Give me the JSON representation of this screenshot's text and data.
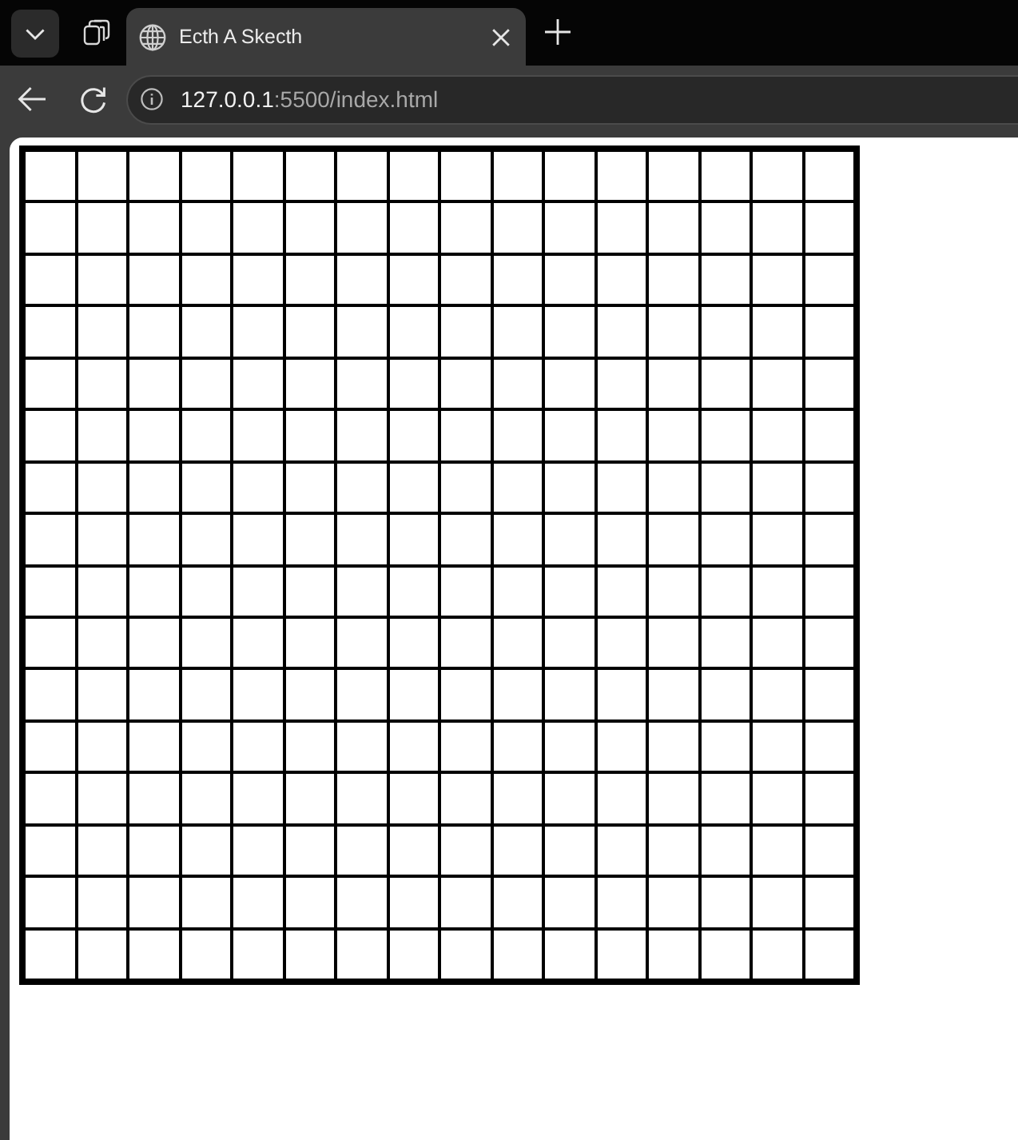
{
  "browser": {
    "tabs": [
      {
        "title": "Ecth A Skecth",
        "selected": true
      }
    ],
    "address_bar": {
      "host": "127.0.0.1",
      "path": ":5500/index.html"
    }
  },
  "page": {
    "grid": {
      "rows": [
        {
          "cells": [
            {
              "filled": false
            },
            {
              "filled": false
            },
            {
              "filled": false
            },
            {
              "filled": false
            },
            {
              "filled": false
            },
            {
              "filled": false
            },
            {
              "filled": false
            },
            {
              "filled": false
            },
            {
              "filled": false
            },
            {
              "filled": false
            },
            {
              "filled": false
            },
            {
              "filled": false
            },
            {
              "filled": false
            },
            {
              "filled": false
            },
            {
              "filled": false
            },
            {
              "filled": false
            }
          ]
        },
        {
          "cells": [
            {
              "filled": false
            },
            {
              "filled": false
            },
            {
              "filled": false
            },
            {
              "filled": false
            },
            {
              "filled": false
            },
            {
              "filled": false
            },
            {
              "filled": false
            },
            {
              "filled": false
            },
            {
              "filled": false
            },
            {
              "filled": false
            },
            {
              "filled": false
            },
            {
              "filled": false
            },
            {
              "filled": false
            },
            {
              "filled": false
            },
            {
              "filled": false
            },
            {
              "filled": false
            }
          ]
        },
        {
          "cells": [
            {
              "filled": false
            },
            {
              "filled": false
            },
            {
              "filled": false
            },
            {
              "filled": false
            },
            {
              "filled": false
            },
            {
              "filled": false
            },
            {
              "filled": false
            },
            {
              "filled": false
            },
            {
              "filled": false
            },
            {
              "filled": false
            },
            {
              "filled": false
            },
            {
              "filled": false
            },
            {
              "filled": false
            },
            {
              "filled": false
            },
            {
              "filled": false
            },
            {
              "filled": false
            }
          ]
        },
        {
          "cells": [
            {
              "filled": false
            },
            {
              "filled": false
            },
            {
              "filled": false
            },
            {
              "filled": false
            },
            {
              "filled": false
            },
            {
              "filled": false
            },
            {
              "filled": false
            },
            {
              "filled": false
            },
            {
              "filled": false
            },
            {
              "filled": false
            },
            {
              "filled": false
            },
            {
              "filled": false
            },
            {
              "filled": false
            },
            {
              "filled": false
            },
            {
              "filled": false
            },
            {
              "filled": false
            }
          ]
        },
        {
          "cells": [
            {
              "filled": false
            },
            {
              "filled": false
            },
            {
              "filled": false
            },
            {
              "filled": false
            },
            {
              "filled": false
            },
            {
              "filled": false
            },
            {
              "filled": false
            },
            {
              "filled": false
            },
            {
              "filled": false
            },
            {
              "filled": false
            },
            {
              "filled": false
            },
            {
              "filled": false
            },
            {
              "filled": false
            },
            {
              "filled": false
            },
            {
              "filled": false
            },
            {
              "filled": false
            }
          ]
        },
        {
          "cells": [
            {
              "filled": false
            },
            {
              "filled": false
            },
            {
              "filled": false
            },
            {
              "filled": false
            },
            {
              "filled": false
            },
            {
              "filled": false
            },
            {
              "filled": false
            },
            {
              "filled": false
            },
            {
              "filled": false
            },
            {
              "filled": false
            },
            {
              "filled": false
            },
            {
              "filled": false
            },
            {
              "filled": false
            },
            {
              "filled": false
            },
            {
              "filled": false
            },
            {
              "filled": false
            }
          ]
        },
        {
          "cells": [
            {
              "filled": false
            },
            {
              "filled": false
            },
            {
              "filled": false
            },
            {
              "filled": false
            },
            {
              "filled": false
            },
            {
              "filled": false
            },
            {
              "filled": false
            },
            {
              "filled": false
            },
            {
              "filled": false
            },
            {
              "filled": false
            },
            {
              "filled": false
            },
            {
              "filled": false
            },
            {
              "filled": false
            },
            {
              "filled": false
            },
            {
              "filled": false
            },
            {
              "filled": false
            }
          ]
        },
        {
          "cells": [
            {
              "filled": false
            },
            {
              "filled": false
            },
            {
              "filled": false
            },
            {
              "filled": false
            },
            {
              "filled": false
            },
            {
              "filled": false
            },
            {
              "filled": false
            },
            {
              "filled": false
            },
            {
              "filled": false
            },
            {
              "filled": false
            },
            {
              "filled": false
            },
            {
              "filled": false
            },
            {
              "filled": false
            },
            {
              "filled": false
            },
            {
              "filled": false
            },
            {
              "filled": false
            }
          ]
        },
        {
          "cells": [
            {
              "filled": false
            },
            {
              "filled": false
            },
            {
              "filled": false
            },
            {
              "filled": false
            },
            {
              "filled": false
            },
            {
              "filled": false
            },
            {
              "filled": false
            },
            {
              "filled": false
            },
            {
              "filled": false
            },
            {
              "filled": false
            },
            {
              "filled": false
            },
            {
              "filled": false
            },
            {
              "filled": false
            },
            {
              "filled": false
            },
            {
              "filled": false
            },
            {
              "filled": false
            }
          ]
        },
        {
          "cells": [
            {
              "filled": false
            },
            {
              "filled": false
            },
            {
              "filled": false
            },
            {
              "filled": false
            },
            {
              "filled": false
            },
            {
              "filled": false
            },
            {
              "filled": false
            },
            {
              "filled": false
            },
            {
              "filled": false
            },
            {
              "filled": false
            },
            {
              "filled": false
            },
            {
              "filled": false
            },
            {
              "filled": false
            },
            {
              "filled": false
            },
            {
              "filled": false
            },
            {
              "filled": false
            }
          ]
        },
        {
          "cells": [
            {
              "filled": false
            },
            {
              "filled": false
            },
            {
              "filled": false
            },
            {
              "filled": false
            },
            {
              "filled": false
            },
            {
              "filled": false
            },
            {
              "filled": false
            },
            {
              "filled": false
            },
            {
              "filled": false
            },
            {
              "filled": false
            },
            {
              "filled": false
            },
            {
              "filled": false
            },
            {
              "filled": false
            },
            {
              "filled": false
            },
            {
              "filled": false
            },
            {
              "filled": false
            }
          ]
        },
        {
          "cells": [
            {
              "filled": false
            },
            {
              "filled": false
            },
            {
              "filled": false
            },
            {
              "filled": false
            },
            {
              "filled": false
            },
            {
              "filled": false
            },
            {
              "filled": false
            },
            {
              "filled": false
            },
            {
              "filled": false
            },
            {
              "filled": false
            },
            {
              "filled": false
            },
            {
              "filled": false
            },
            {
              "filled": false
            },
            {
              "filled": false
            },
            {
              "filled": false
            },
            {
              "filled": false
            }
          ]
        },
        {
          "cells": [
            {
              "filled": false
            },
            {
              "filled": false
            },
            {
              "filled": false
            },
            {
              "filled": false
            },
            {
              "filled": false
            },
            {
              "filled": false
            },
            {
              "filled": false
            },
            {
              "filled": false
            },
            {
              "filled": false
            },
            {
              "filled": false
            },
            {
              "filled": false
            },
            {
              "filled": false
            },
            {
              "filled": false
            },
            {
              "filled": false
            },
            {
              "filled": false
            },
            {
              "filled": false
            }
          ]
        },
        {
          "cells": [
            {
              "filled": false
            },
            {
              "filled": false
            },
            {
              "filled": false
            },
            {
              "filled": false
            },
            {
              "filled": false
            },
            {
              "filled": false
            },
            {
              "filled": false
            },
            {
              "filled": false
            },
            {
              "filled": false
            },
            {
              "filled": false
            },
            {
              "filled": false
            },
            {
              "filled": false
            },
            {
              "filled": false
            },
            {
              "filled": false
            },
            {
              "filled": false
            },
            {
              "filled": false
            }
          ]
        },
        {
          "cells": [
            {
              "filled": false
            },
            {
              "filled": false
            },
            {
              "filled": false
            },
            {
              "filled": false
            },
            {
              "filled": false
            },
            {
              "filled": false
            },
            {
              "filled": false
            },
            {
              "filled": false
            },
            {
              "filled": false
            },
            {
              "filled": false
            },
            {
              "filled": false
            },
            {
              "filled": false
            },
            {
              "filled": false
            },
            {
              "filled": false
            },
            {
              "filled": false
            },
            {
              "filled": false
            }
          ]
        },
        {
          "cells": [
            {
              "filled": false
            },
            {
              "filled": false
            },
            {
              "filled": false
            },
            {
              "filled": false
            },
            {
              "filled": false
            },
            {
              "filled": false
            },
            {
              "filled": false
            },
            {
              "filled": false
            },
            {
              "filled": false
            },
            {
              "filled": false
            },
            {
              "filled": false
            },
            {
              "filled": false
            },
            {
              "filled": false
            },
            {
              "filled": false
            },
            {
              "filled": false
            },
            {
              "filled": false
            }
          ]
        }
      ]
    }
  }
}
